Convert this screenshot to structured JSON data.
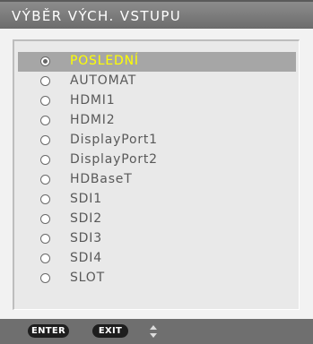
{
  "title": "VÝBĚR VÝCH. VSTUPU",
  "items": [
    {
      "label": "POSLEDNÍ",
      "selected": true
    },
    {
      "label": "AUTOMAT",
      "selected": false
    },
    {
      "label": "HDMI1",
      "selected": false
    },
    {
      "label": "HDMI2",
      "selected": false
    },
    {
      "label": "DisplayPort1",
      "selected": false
    },
    {
      "label": "DisplayPort2",
      "selected": false
    },
    {
      "label": "HDBaseT",
      "selected": false
    },
    {
      "label": "SDI1",
      "selected": false
    },
    {
      "label": "SDI2",
      "selected": false
    },
    {
      "label": "SDI3",
      "selected": false
    },
    {
      "label": "SDI4",
      "selected": false
    },
    {
      "label": "SLOT",
      "selected": false
    }
  ],
  "footer": {
    "enter_label": "ENTER",
    "exit_label": "EXIT",
    "nav_icon": "up-down-arrows-icon"
  },
  "colors": {
    "selected_text": "#ffff00",
    "selected_row": "#a6a6a6",
    "title_bar": "#7a7a7a",
    "footer_bar": "#6f6f6f"
  }
}
